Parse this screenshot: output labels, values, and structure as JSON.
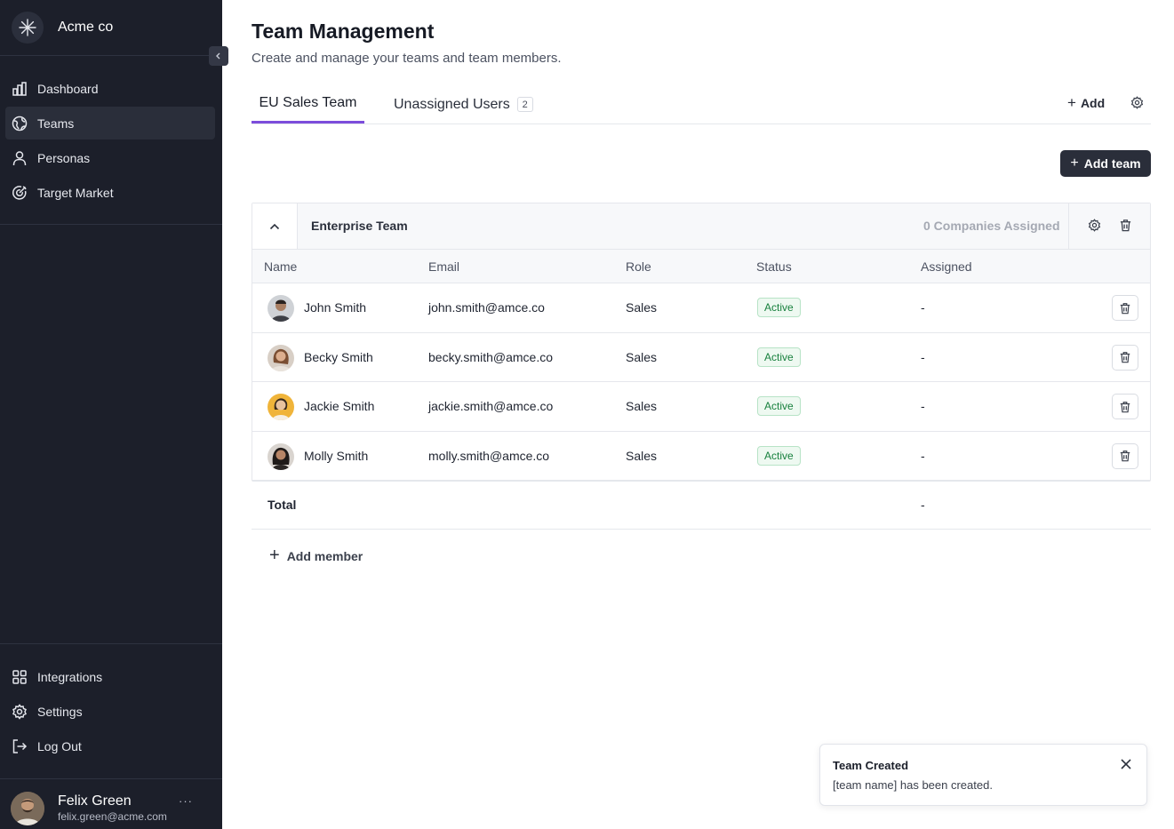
{
  "app": {
    "name": "Acme co"
  },
  "sidebar": {
    "nav": [
      {
        "label": "Dashboard",
        "icon": "bar-chart-icon",
        "active": false
      },
      {
        "label": "Teams",
        "icon": "globe-icon",
        "active": true
      },
      {
        "label": "Personas",
        "icon": "user-icon",
        "active": false
      },
      {
        "label": "Target Market",
        "icon": "target-icon",
        "active": false
      }
    ],
    "bottom_nav": [
      {
        "label": "Integrations",
        "icon": "grid-icon"
      },
      {
        "label": "Settings",
        "icon": "gear-icon"
      },
      {
        "label": "Log Out",
        "icon": "logout-icon"
      }
    ],
    "user": {
      "name": "Felix Green",
      "email": "felix.green@acme.com",
      "more": "···"
    }
  },
  "page": {
    "title": "Team Management",
    "subtitle": "Create and manage your teams and team members."
  },
  "tabs": [
    {
      "label": "EU Sales Team",
      "active": true
    },
    {
      "label": "Unassigned Users",
      "badge": "2",
      "active": false
    }
  ],
  "tab_actions": {
    "add_label": "Add"
  },
  "add_team_label": "Add team",
  "team": {
    "name": "Enterprise Team",
    "assigned_summary": "0 Companies Assigned",
    "columns": [
      "Name",
      "Email",
      "Role",
      "Status",
      "Assigned"
    ],
    "members": [
      {
        "name": "John Smith",
        "email": "john.smith@amce.co",
        "role": "Sales",
        "status": "Active",
        "assigned": "-"
      },
      {
        "name": "Becky Smith",
        "email": "becky.smith@amce.co",
        "role": "Sales",
        "status": "Active",
        "assigned": "-"
      },
      {
        "name": "Jackie Smith",
        "email": "jackie.smith@amce.co",
        "role": "Sales",
        "status": "Active",
        "assigned": "-"
      },
      {
        "name": "Molly Smith",
        "email": "molly.smith@amce.co",
        "role": "Sales",
        "status": "Active",
        "assigned": "-"
      }
    ],
    "total": {
      "label": "Total",
      "assigned": "-"
    },
    "add_member_label": "Add member"
  },
  "toast": {
    "title": "Team Created",
    "body": "[team name] has been created."
  },
  "colors": {
    "sidebar_bg": "#1c1f2a",
    "accent": "#7c4ddb",
    "primary_button": "#2a2e3a",
    "status_active": "#17803d"
  }
}
